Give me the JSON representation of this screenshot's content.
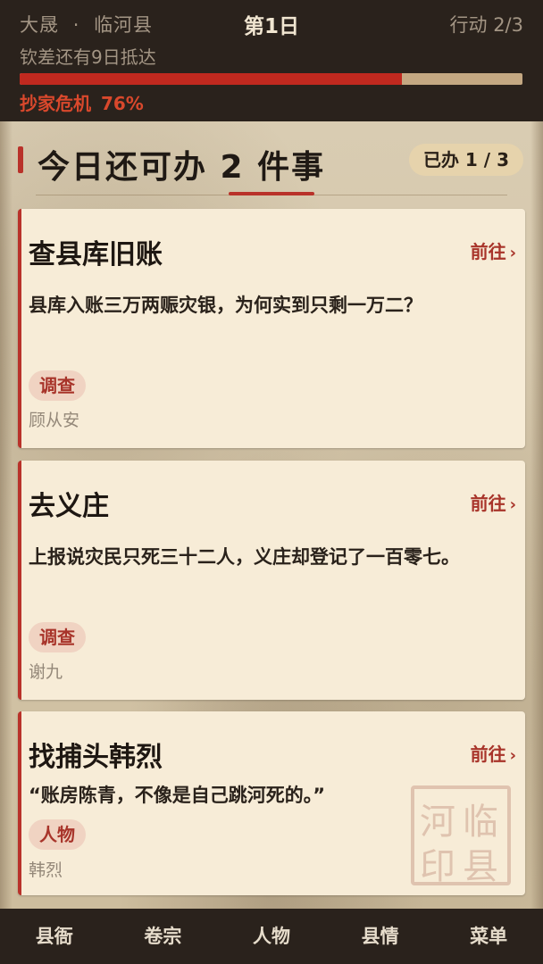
{
  "header": {
    "dynasty": "大晟",
    "separator": "·",
    "county": "临河县",
    "day": "第1日",
    "action": "行动 2/3",
    "notice": "钦差还有9日抵达",
    "crisis_label": "抄家危机",
    "crisis_value": "76%",
    "crisis_progress": 0.76
  },
  "main": {
    "title": "今日还可办 2 件事",
    "done_badge": "已办 1 / 3"
  },
  "tasks": [
    {
      "title": "查县库旧账",
      "go_label": "前往",
      "description": "县库入账三万两赈灾银，为何实到只剩一万二？",
      "tag": "调查",
      "person": "顾从安"
    },
    {
      "title": "去义庄",
      "go_label": "前往",
      "description": "上报说灾民只死三十二人，义庄却登记了一百零七。",
      "tag": "调查",
      "person": "谢九"
    },
    {
      "title": "找捕头韩烈",
      "go_label": "前往",
      "description": "“账房陈青，不像是自己跳河死的。”",
      "tag": "人物",
      "person": "韩烈"
    }
  ],
  "seal": {
    "chars": [
      "临",
      "河",
      "县",
      "印"
    ]
  },
  "nav": [
    "县衙",
    "卷宗",
    "人物",
    "县情",
    "菜单"
  ],
  "colors": {
    "accent_red": "#b9322a",
    "crisis_fill": "#c0291f",
    "header_bg": "#2a221c",
    "card_bg": "#f7ecd7"
  }
}
